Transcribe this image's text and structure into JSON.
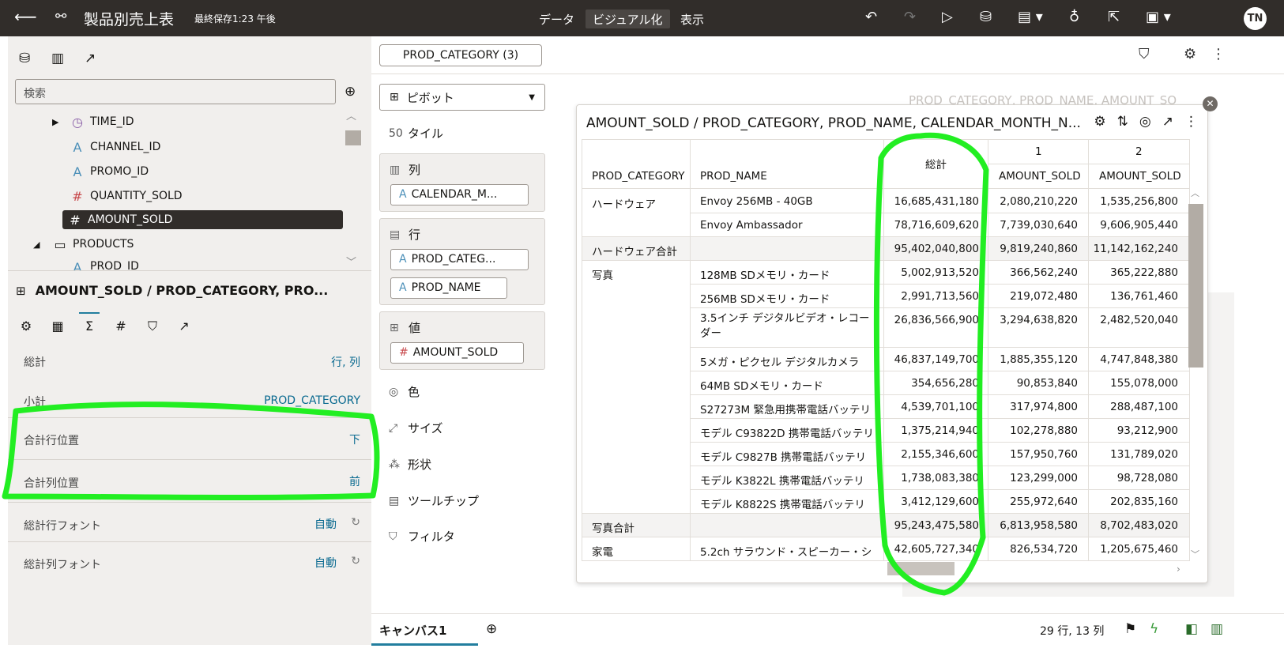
{
  "topbar": {
    "title": "製品別売上表",
    "saved": "最終保存1:23 午後",
    "tabs": [
      "データ",
      "ビジュアル化",
      "表示"
    ]
  },
  "avatar": "TN",
  "left": {
    "search_placeholder": "検索",
    "tree": [
      "TIME_ID",
      "CHANNEL_ID",
      "PROMO_ID",
      "QUANTITY_SOLD",
      "AMOUNT_SOLD",
      "PRODUCTS",
      "PROD_ID"
    ],
    "panel_title": "AMOUNT_SOLD / PROD_CATEGORY, PRO...",
    "props": [
      {
        "label": "総計",
        "value": "行, 列"
      },
      {
        "label": "小計",
        "value": "PROD_CATEGORY"
      },
      {
        "label": "合計行位置",
        "value": "下"
      },
      {
        "label": "合計列位置",
        "value": "前"
      },
      {
        "label": "総計行フォント",
        "value": "自動"
      },
      {
        "label": "総計列フォント",
        "value": "自動"
      }
    ]
  },
  "filter_chip": "PROD_CATEGORY (3)",
  "grammar": {
    "viz_type": "ピボット",
    "tile": "タイル",
    "columns": "列",
    "columns_pill": "CALENDAR_M...",
    "rows": "行",
    "rows_pill1": "PROD_CATEG...",
    "rows_pill2": "PROD_NAME",
    "values": "値",
    "values_pill": "AMOUNT_SOLD",
    "color": "色",
    "size": "サイズ",
    "shape": "形状",
    "tooltip": "ツールチップ",
    "filter": "フィルタ"
  },
  "ghost_title": "PROD_CATEGORY, PROD_NAME, AMOUNT_SO",
  "viz": {
    "title": "AMOUNT_SOLD / PROD_CATEGORY, PROD_NAME, CALENDAR_MONTH_N...",
    "headers": {
      "cat": "PROD_CATEGORY",
      "name": "PROD_NAME",
      "total": "総計",
      "m1": "1",
      "m2": "2",
      "m1sub": "AMOUNT_SOLD",
      "m2sub": "AMOUNT_SOLD"
    },
    "rows": [
      {
        "cat": "ハードウェア",
        "name": "Envoy 256MB - 40GB",
        "total": "16,685,431,180",
        "m1": "2,080,210,220",
        "m2": "1,535,256,800"
      },
      {
        "cat": "",
        "name": "Envoy Ambassador",
        "total": "78,716,609,620",
        "m1": "7,739,030,640",
        "m2": "9,606,905,440"
      },
      {
        "cat": "ハードウェア合計",
        "name": "",
        "total": "95,402,040,800",
        "m1": "9,819,240,860",
        "m2": "11,142,162,240"
      },
      {
        "cat": "写真",
        "name": "128MB SDメモリ・カード",
        "total": "5,002,913,520",
        "m1": "366,562,240",
        "m2": "365,222,880"
      },
      {
        "cat": "",
        "name": "256MB SDメモリ・カード",
        "total": "2,991,713,560",
        "m1": "219,072,480",
        "m2": "136,761,460"
      },
      {
        "cat": "",
        "name": "3.5インチ デジタルビデオ・レコーダー",
        "total": "26,836,566,900",
        "m1": "3,294,638,820",
        "m2": "2,482,520,040"
      },
      {
        "cat": "",
        "name": "5メガ・ピクセル デジタルカメラ",
        "total": "46,837,149,700",
        "m1": "1,885,355,120",
        "m2": "4,747,848,380"
      },
      {
        "cat": "",
        "name": "64MB SDメモリ・カード",
        "total": "354,656,280",
        "m1": "90,853,840",
        "m2": "155,078,000"
      },
      {
        "cat": "",
        "name": "S27273M 緊急用携帯電話バッテリ",
        "total": "4,539,701,100",
        "m1": "317,974,800",
        "m2": "288,487,100"
      },
      {
        "cat": "",
        "name": "モデル C93822D 携帯電話バッテリ",
        "total": "1,375,214,940",
        "m1": "102,278,880",
        "m2": "93,212,900"
      },
      {
        "cat": "",
        "name": "モデル C9827B 携帯電話バッテリ",
        "total": "2,155,346,600",
        "m1": "157,950,760",
        "m2": "131,789,020"
      },
      {
        "cat": "",
        "name": "モデル K3822L 携帯電話バッテリ",
        "total": "1,738,083,380",
        "m1": "123,299,000",
        "m2": "98,728,080"
      },
      {
        "cat": "",
        "name": "モデル K8822S 携帯電話バッテリ",
        "total": "3,412,129,600",
        "m1": "255,972,640",
        "m2": "202,835,160"
      },
      {
        "cat": "写真合計",
        "name": "",
        "total": "95,243,475,580",
        "m1": "6,813,958,580",
        "m2": "8,702,483,020"
      },
      {
        "cat": "家電",
        "name": "5.2ch サラウンド・スピーカー・シ",
        "total": "42,605,727,340",
        "m1": "826,534,720",
        "m2": "1,205,675,460"
      }
    ]
  },
  "canvas_tab": "キャンバス1",
  "rowcount": "29 行, 13 列",
  "annotation_color": "#22ee22"
}
